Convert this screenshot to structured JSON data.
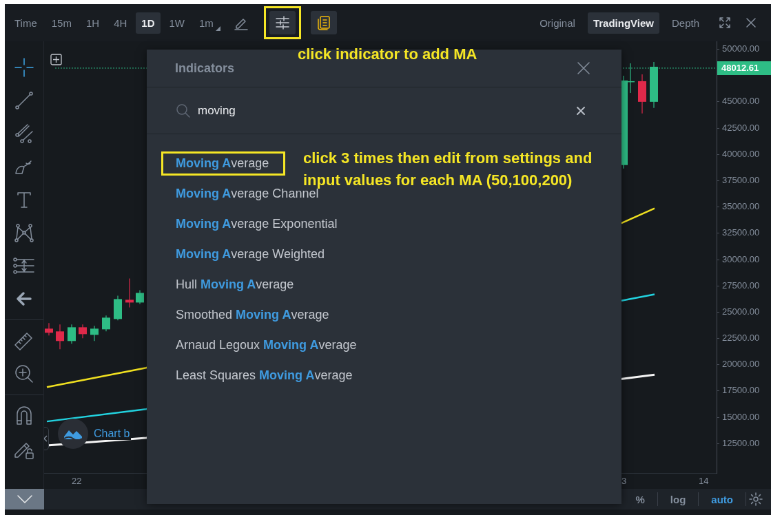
{
  "toolbar": {
    "intervals": [
      {
        "label": "Time",
        "selected": false,
        "menu": false
      },
      {
        "label": "15m",
        "selected": false,
        "menu": false
      },
      {
        "label": "1H",
        "selected": false,
        "menu": false
      },
      {
        "label": "4H",
        "selected": false,
        "menu": false
      },
      {
        "label": "1D",
        "selected": true,
        "menu": false
      },
      {
        "label": "1W",
        "selected": false,
        "menu": false
      },
      {
        "label": "1m",
        "selected": false,
        "menu": true
      }
    ],
    "tools": [
      {
        "kind": "draw",
        "annotated": false
      },
      {
        "kind": "indicators",
        "annotated": true
      },
      {
        "kind": "templates",
        "annotated": false
      }
    ],
    "views": [
      {
        "label": "Original",
        "selected": false
      },
      {
        "label": "TradingView",
        "selected": true
      },
      {
        "label": "Depth",
        "selected": false
      }
    ]
  },
  "chart": {
    "attribution": "Chart b",
    "price_axis": [
      "50000.00",
      "45000.00",
      "42500.00",
      "40000.00",
      "37500.00",
      "35000.00",
      "32500.00",
      "30000.00",
      "27500.00",
      "25000.00",
      "22500.00",
      "20000.00",
      "17500.00",
      "15000.00",
      "12500.00"
    ],
    "last_price": "48012.61",
    "time_axis": [
      "22",
      "3",
      "14"
    ]
  },
  "bottom_bar": [
    {
      "label": "%",
      "selected": false
    },
    {
      "label": "log",
      "selected": false
    },
    {
      "label": "auto",
      "selected": true
    }
  ],
  "dialog": {
    "title": "Indicators",
    "search": {
      "value": "moving"
    },
    "results": [
      {
        "annotated": true,
        "parts": [
          {
            "text": "Moving A",
            "match": true
          },
          {
            "text": "verage",
            "match": false
          }
        ]
      },
      {
        "annotated": false,
        "parts": [
          {
            "text": "Moving A",
            "match": true
          },
          {
            "text": "verage Channel",
            "match": false
          }
        ]
      },
      {
        "annotated": false,
        "parts": [
          {
            "text": "Moving A",
            "match": true
          },
          {
            "text": "verage Exponential",
            "match": false
          }
        ]
      },
      {
        "annotated": false,
        "parts": [
          {
            "text": "Moving A",
            "match": true
          },
          {
            "text": "verage Weighted",
            "match": false
          }
        ]
      },
      {
        "annotated": false,
        "parts": [
          {
            "text": "Hull ",
            "match": false
          },
          {
            "text": "Moving A",
            "match": true
          },
          {
            "text": "verage",
            "match": false
          }
        ]
      },
      {
        "annotated": false,
        "parts": [
          {
            "text": "Smoothed ",
            "match": false
          },
          {
            "text": "Moving A",
            "match": true
          },
          {
            "text": "verage",
            "match": false
          }
        ]
      },
      {
        "annotated": false,
        "parts": [
          {
            "text": "Arnaud Legoux ",
            "match": false
          },
          {
            "text": "Moving A",
            "match": true
          },
          {
            "text": "verage",
            "match": false
          }
        ]
      },
      {
        "annotated": false,
        "parts": [
          {
            "text": "Least Squares ",
            "match": false
          },
          {
            "text": "Moving A",
            "match": true
          },
          {
            "text": "verage",
            "match": false
          }
        ]
      }
    ]
  },
  "annotations": [
    "click indicator to add MA",
    "click 3 times then edit from settings and input values for each MA (50,100,200)"
  ]
}
